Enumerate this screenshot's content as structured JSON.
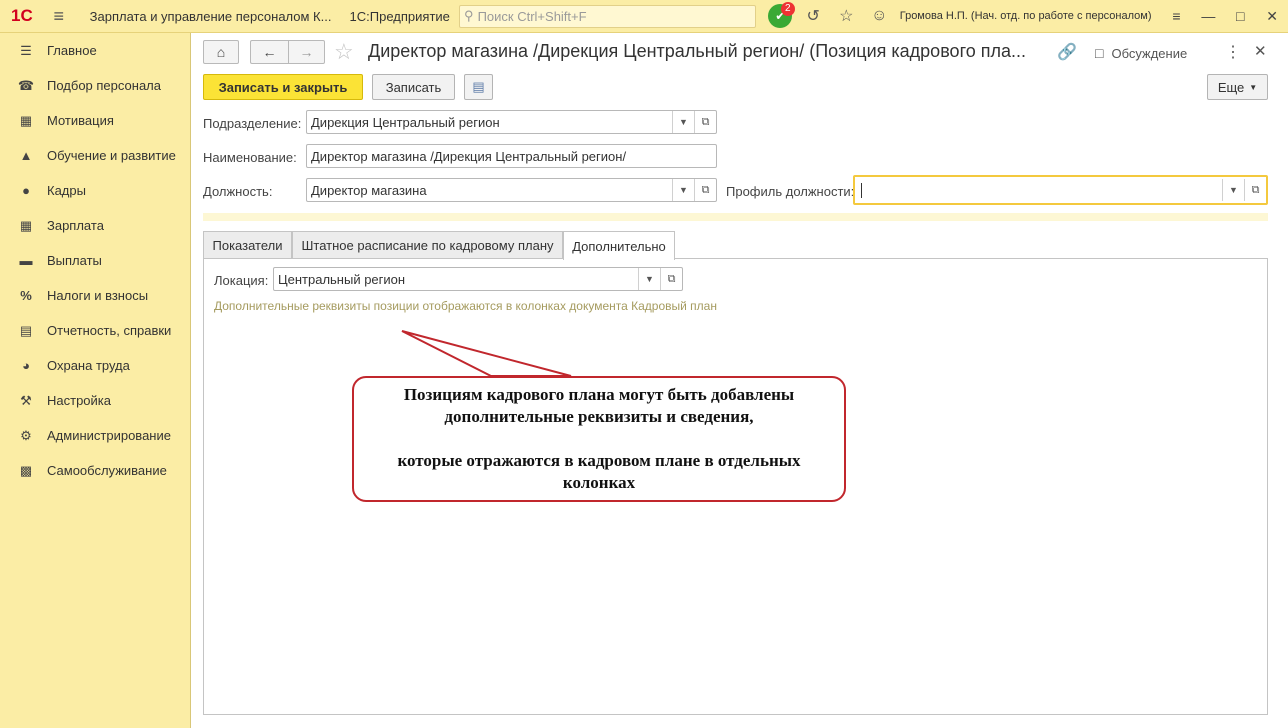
{
  "titlebar": {
    "logo": "1С",
    "app_name": "Зарплата и управление персоналом К...",
    "platform": "1С:Предприятие",
    "search_placeholder": "Поиск Ctrl+Shift+F",
    "notifications_count": "2",
    "user": "Громова Н.П. (Нач. отд. по работе с персоналом)"
  },
  "sidebar": {
    "items": [
      {
        "label": "Главное",
        "icon": "menu-icon"
      },
      {
        "label": "Подбор персонала",
        "icon": "phone-icon"
      },
      {
        "label": "Мотивация",
        "icon": "gift-icon"
      },
      {
        "label": "Обучение и развитие",
        "icon": "graduation-cap-icon"
      },
      {
        "label": "Кадры",
        "icon": "people-icon"
      },
      {
        "label": "Зарплата",
        "icon": "calculator-icon"
      },
      {
        "label": "Выплаты",
        "icon": "wallet-icon"
      },
      {
        "label": "Налоги и взносы",
        "icon": "percent-icon"
      },
      {
        "label": "Отчетность, справки",
        "icon": "report-icon"
      },
      {
        "label": "Охрана труда",
        "icon": "helmet-icon"
      },
      {
        "label": "Настройка",
        "icon": "wrench-icon"
      },
      {
        "label": "Администрирование",
        "icon": "gear-icon"
      },
      {
        "label": "Самообслуживание",
        "icon": "id-card-icon"
      }
    ]
  },
  "document": {
    "title": "Директор магазина /Дирекция Центральный регион/ (Позиция кадрового пла...",
    "discussion_label": "Обсуждение"
  },
  "toolbar": {
    "save_close_label": "Записать и закрыть",
    "save_label": "Записать",
    "more_label": "Еще"
  },
  "form": {
    "department_label": "Подразделение:",
    "department_value": "Дирекция Центральный регион",
    "name_label": "Наименование:",
    "name_value": "Директор магазина /Дирекция Центральный регион/",
    "position_label": "Должность:",
    "position_value": "Директор магазина",
    "profile_label": "Профиль должности:",
    "profile_value": ""
  },
  "tabs": [
    {
      "label": "Показатели",
      "active": false
    },
    {
      "label": "Штатное расписание по кадровому плану",
      "active": false
    },
    {
      "label": "Дополнительно",
      "active": true
    }
  ],
  "extra": {
    "location_label": "Локация:",
    "location_value": "Центральный регион",
    "hint": "Дополнительные реквизиты позиции отображаются в  колонках документа Кадровый план"
  },
  "callout": {
    "line1": "Позициям кадрового плана могут быть добавлены",
    "line2": "дополнительные реквизиты и сведения,",
    "line3": "которые отражаются в кадровом плане в отдельных",
    "line4": "колонках"
  },
  "colors": {
    "panel_bg": "#fbeda5",
    "primary_button": "#fbe336",
    "callout_border": "#c1272d",
    "focus_border": "#f4c93e"
  }
}
